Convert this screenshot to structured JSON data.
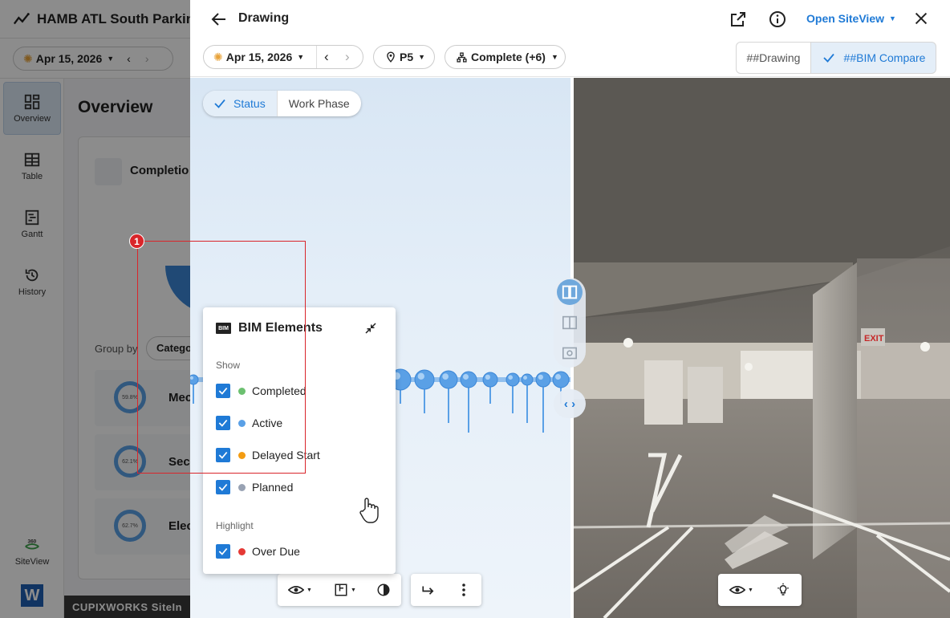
{
  "background_app": {
    "project_title": "HAMB ATL South Parking",
    "date": "Apr 15, 2026",
    "overview_title": "Overview",
    "card_title": "Completio",
    "group_by_label": "Group by",
    "group_by_value": "Catego",
    "rows": [
      {
        "percent": "59.8%",
        "label": "Mecha"
      },
      {
        "percent": "62.1%",
        "label": "Securi"
      },
      {
        "percent": "62.7%",
        "label": "Electri"
      }
    ],
    "sidebar": [
      {
        "label": "Overview",
        "icon": "dashboard-icon"
      },
      {
        "label": "Table",
        "icon": "table-icon"
      },
      {
        "label": "Gantt",
        "icon": "gantt-icon"
      },
      {
        "label": "History",
        "icon": "history-icon"
      },
      {
        "label": "SiteView",
        "icon": "siteview-360-icon"
      }
    ],
    "footer_brand": "CUPIXWORKS",
    "footer_brand_suffix": "SiteIn",
    "siteview_badge": "360"
  },
  "drawing": {
    "title": "Drawing",
    "open_siteview_label": "Open SiteView",
    "toolbar": {
      "date": "Apr 15, 2026",
      "level": "P5",
      "status_filter": "Complete (+6)"
    },
    "view_tabs": [
      {
        "label": "##Drawing",
        "selected": false
      },
      {
        "label": "##BIM Compare",
        "selected": true
      }
    ],
    "color_mode": {
      "options": [
        {
          "label": "Status",
          "selected": true
        },
        {
          "label": "Work Phase",
          "selected": false
        }
      ]
    },
    "photo_signs": {
      "exit": "EXIT"
    }
  },
  "bim_panel": {
    "badge": "BIM",
    "title": "BIM Elements",
    "show_label": "Show",
    "show_items": [
      {
        "label": "Completed",
        "color": "#6cc070",
        "checked": true
      },
      {
        "label": "Active",
        "color": "#5aa0e6",
        "checked": true
      },
      {
        "label": "Delayed Start",
        "color": "#f39c12",
        "checked": true
      },
      {
        "label": "Planned",
        "color": "#98a2b3",
        "checked": true
      }
    ],
    "highlight_label": "Highlight",
    "highlight_items": [
      {
        "label": "Over Due",
        "color": "#e53935",
        "checked": true
      }
    ]
  },
  "annotation": {
    "number": "1",
    "color": "#d9252a"
  },
  "colors": {
    "accent": "#1f7ad6",
    "selected_bg": "#e4eef8"
  }
}
